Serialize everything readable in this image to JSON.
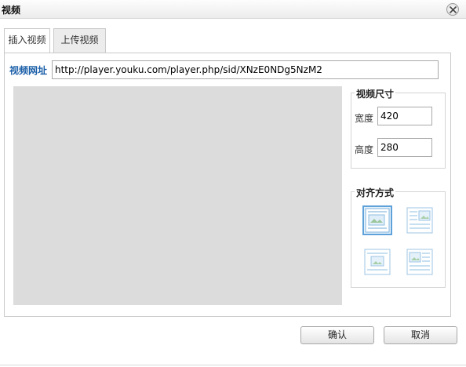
{
  "dialog": {
    "title": "视频"
  },
  "tabs": [
    {
      "label": "插入视频",
      "active": true
    },
    {
      "label": "上传视频",
      "active": false
    }
  ],
  "url": {
    "label": "视频网址",
    "value": "http://player.youku.com/player.php/sid/XNzE0NDg5NzM2"
  },
  "size": {
    "legend": "视频尺寸",
    "width_label": "宽度",
    "width_value": "420",
    "height_label": "高度",
    "height_value": "280"
  },
  "align": {
    "legend": "对齐方式",
    "options": [
      {
        "name": "align-none-icon",
        "selected": true
      },
      {
        "name": "align-right-icon",
        "selected": false
      },
      {
        "name": "align-center-icon",
        "selected": false
      },
      {
        "name": "align-left-icon",
        "selected": false
      }
    ]
  },
  "buttons": {
    "ok": "确认",
    "cancel": "取消"
  },
  "colors": {
    "accent": "#1b5fa8",
    "preview_bg": "#dcdcdc",
    "selected_border": "#5fa2da"
  }
}
